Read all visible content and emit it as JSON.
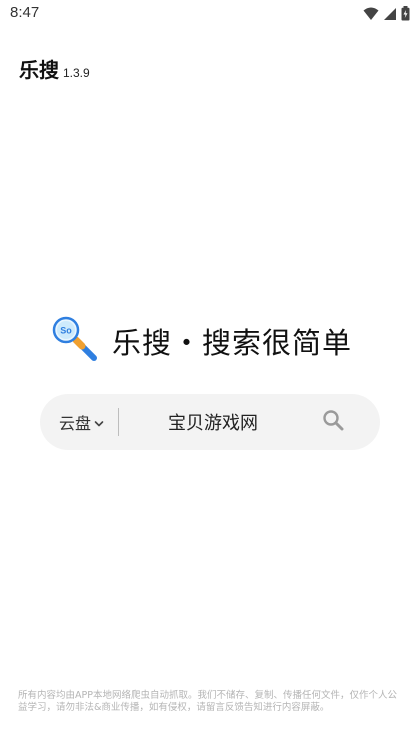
{
  "status_bar": {
    "time": "8:47",
    "icons": [
      "wifi-icon",
      "cellular-signal-icon",
      "battery-icon"
    ]
  },
  "header": {
    "app_name": "乐搜",
    "version": "1.3.9"
  },
  "hero": {
    "logo_icon": "magnifier-logo-icon",
    "logo_text": "So",
    "slogan": "乐搜・搜索很简单"
  },
  "search": {
    "scope_label": "云盘",
    "scope_icon": "chevron-down-icon",
    "query": "宝贝游戏网",
    "search_icon": "search-icon"
  },
  "footer": {
    "disclaimer": "所有内容均由APP本地网络爬虫自动抓取。我们不储存、复制、传播任何文件，仅作个人公益学习，请勿非法&商业传播，如有侵权，请留言反馈告知进行内容屏蔽。"
  },
  "colors": {
    "logo_blue": "#2f7fe0",
    "logo_orange": "#f0a030",
    "search_bg": "#f3f3f3",
    "disclaimer_text": "#b5b5b5"
  }
}
